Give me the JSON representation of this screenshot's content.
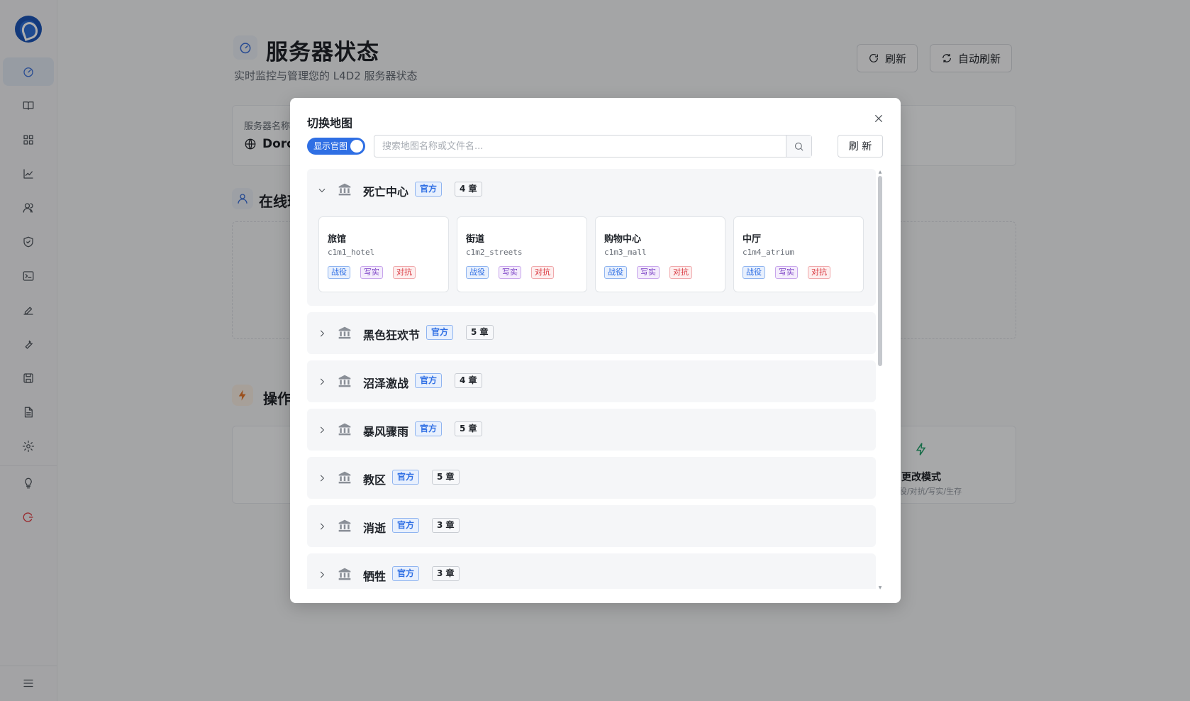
{
  "page": {
    "title": "服务器状态",
    "subtitle": "实时监控与管理您的 L4D2 服务器状态",
    "refresh_label": "刷新",
    "auto_refresh_label": "自动刷新",
    "server_name_label": "服务器名称",
    "server_name_value": "Doro",
    "online_section": "在线玩",
    "ops_section": "操作",
    "change_mode_label": "更改模式",
    "change_mode_sub": "役/对抗/写实/生存"
  },
  "modal": {
    "title": "切换地图",
    "toggle_label": "显示官图",
    "search_placeholder": "搜索地图名称或文件名...",
    "refresh_label": "刷 新"
  },
  "campaigns": [
    {
      "name": "死亡中心",
      "official": "官方",
      "chapters": "4 章",
      "expanded": true,
      "maps": [
        {
          "name": "旅馆",
          "file": "c1m1_hotel",
          "tags": [
            "战役",
            "写实",
            "对抗"
          ]
        },
        {
          "name": "街道",
          "file": "c1m2_streets",
          "tags": [
            "战役",
            "写实",
            "对抗"
          ]
        },
        {
          "name": "购物中心",
          "file": "c1m3_mall",
          "tags": [
            "战役",
            "写实",
            "对抗"
          ]
        },
        {
          "name": "中厅",
          "file": "c1m4_atrium",
          "tags": [
            "战役",
            "写实",
            "对抗"
          ]
        }
      ]
    },
    {
      "name": "黑色狂欢节",
      "official": "官方",
      "chapters": "5 章"
    },
    {
      "name": "沼泽激战",
      "official": "官方",
      "chapters": "4 章"
    },
    {
      "name": "暴风骤雨",
      "official": "官方",
      "chapters": "5 章"
    },
    {
      "name": "教区",
      "official": "官方",
      "chapters": "5 章"
    },
    {
      "name": "消逝",
      "official": "官方",
      "chapters": "3 章"
    },
    {
      "name": "牺牲",
      "official": "官方",
      "chapters": "3 章"
    }
  ],
  "colors": {
    "accent": "#2f6fe4",
    "danger": "#e0363d"
  }
}
